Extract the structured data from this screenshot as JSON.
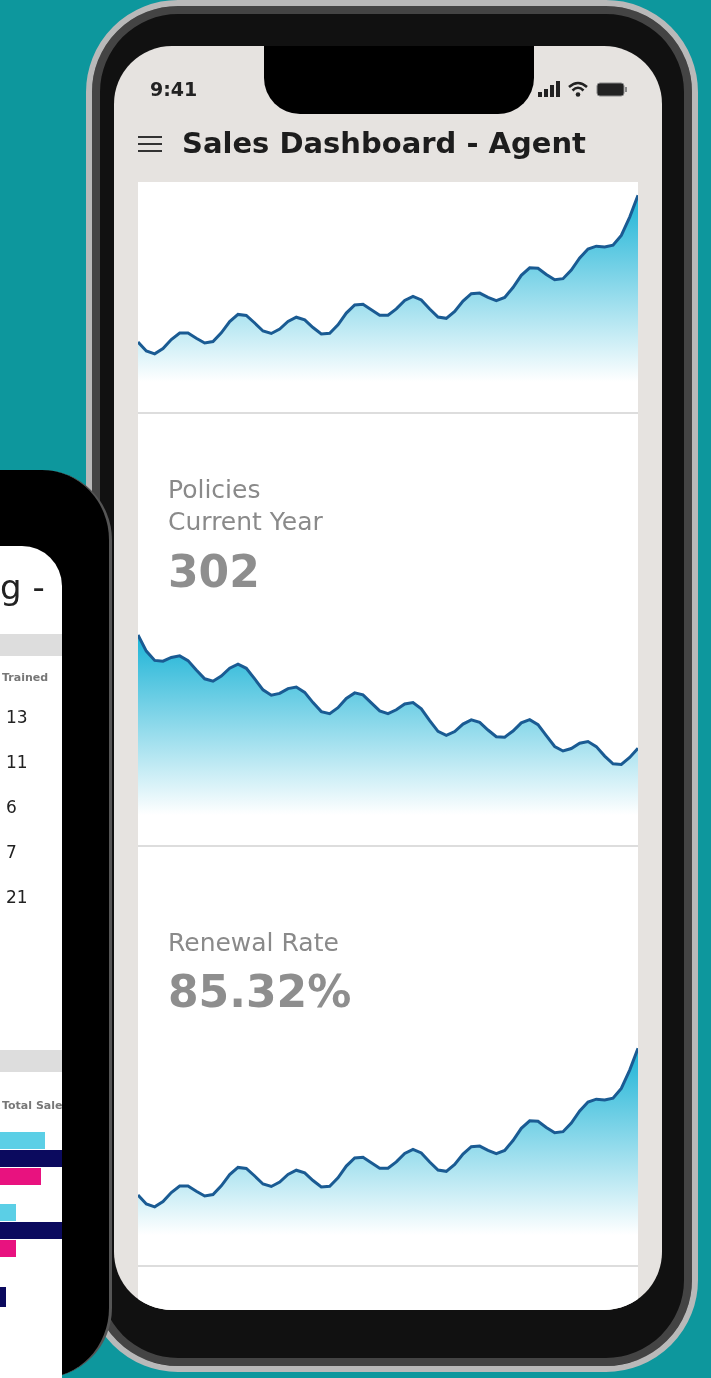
{
  "back_phone": {
    "title": "g -",
    "table": {
      "column_header": "Trained",
      "rows": [
        "13",
        "11",
        "6",
        "7",
        "21"
      ]
    },
    "chart": {
      "column_header": "Total Sale"
    }
  },
  "front_phone": {
    "status_bar": {
      "time": "9:41"
    },
    "app_bar": {
      "title": "Sales Dashboard - Agent"
    },
    "cards": [
      {
        "label": "Policies Current Year",
        "value": "302"
      },
      {
        "label": "Renewal Rate",
        "value": "85.32%"
      }
    ]
  }
}
